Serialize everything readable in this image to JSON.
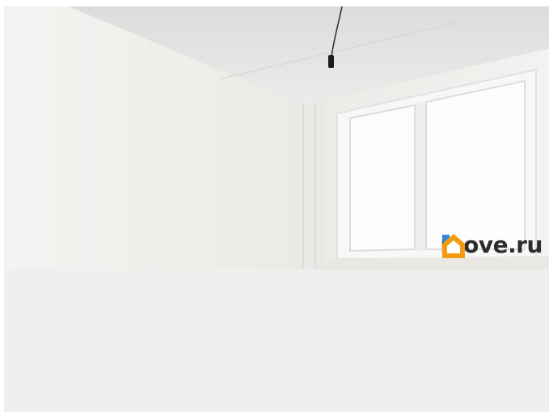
{
  "photo": {
    "subject": "empty-room-photo",
    "watermark": {
      "icon": "house-icon",
      "text": "move.ru",
      "icon_color": "#f39c12",
      "icon_accent": "#2e86de"
    }
  },
  "colors": {
    "lower_panel": "#efefef",
    "wall": "#f1efec",
    "ceiling": "#e6e6e4"
  }
}
